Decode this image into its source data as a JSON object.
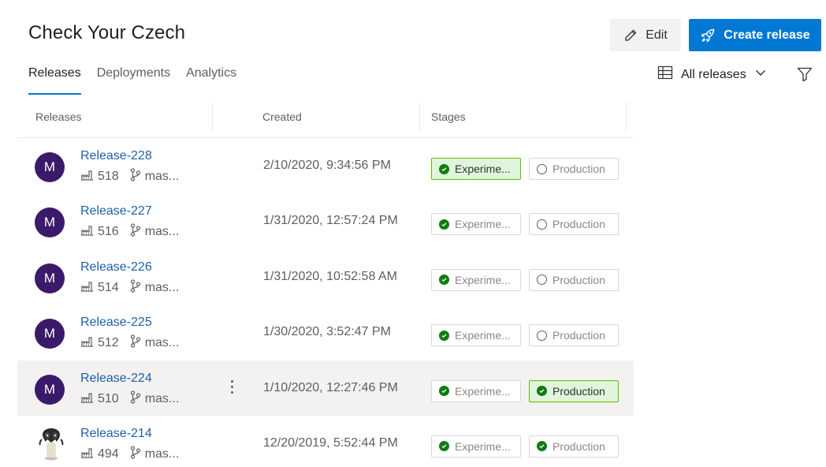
{
  "header": {
    "title": "Check Your Czech",
    "edit_label": "Edit",
    "create_label": "Create release"
  },
  "tabs": [
    {
      "label": "Releases",
      "active": true
    },
    {
      "label": "Deployments",
      "active": false
    },
    {
      "label": "Analytics",
      "active": false
    }
  ],
  "view": {
    "label": "All releases",
    "icon": "table-grid-icon",
    "filter_icon": "filter-icon"
  },
  "table": {
    "columns": [
      "Releases",
      "Created",
      "Stages"
    ],
    "rows": [
      {
        "name": "Release-228",
        "build": "518",
        "branch": "mas...",
        "created": "2/10/2020, 9:34:56 PM",
        "avatar": "M",
        "stages": [
          {
            "label": "Experime...",
            "status": "succeeded",
            "highlight": true
          },
          {
            "label": "Production",
            "status": "not-deployed",
            "highlight": false
          }
        ]
      },
      {
        "name": "Release-227",
        "build": "516",
        "branch": "mas...",
        "created": "1/31/2020, 12:57:24 PM",
        "avatar": "M",
        "stages": [
          {
            "label": "Experime...",
            "status": "succeeded",
            "highlight": false
          },
          {
            "label": "Production",
            "status": "not-deployed",
            "highlight": false
          }
        ]
      },
      {
        "name": "Release-226",
        "build": "514",
        "branch": "mas...",
        "created": "1/31/2020, 10:52:58 AM",
        "avatar": "M",
        "stages": [
          {
            "label": "Experime...",
            "status": "succeeded",
            "highlight": false
          },
          {
            "label": "Production",
            "status": "not-deployed",
            "highlight": false
          }
        ]
      },
      {
        "name": "Release-225",
        "build": "512",
        "branch": "mas...",
        "created": "1/30/2020, 3:52:47 PM",
        "avatar": "M",
        "stages": [
          {
            "label": "Experime...",
            "status": "succeeded",
            "highlight": false
          },
          {
            "label": "Production",
            "status": "not-deployed",
            "highlight": false
          }
        ]
      },
      {
        "name": "Release-224",
        "build": "510",
        "branch": "mas...",
        "created": "1/10/2020, 12:27:46 PM",
        "avatar": "M",
        "selected": true,
        "stages": [
          {
            "label": "Experime...",
            "status": "succeeded",
            "highlight": false
          },
          {
            "label": "Production",
            "status": "succeeded",
            "highlight": true
          }
        ]
      },
      {
        "name": "Release-214",
        "build": "494",
        "branch": "mas...",
        "created": "12/20/2019, 5:52:44 PM",
        "avatar": "image",
        "stages": [
          {
            "label": "Experime...",
            "status": "succeeded",
            "highlight": false
          },
          {
            "label": "Production",
            "status": "succeeded",
            "highlight": false
          }
        ]
      }
    ]
  },
  "colors": {
    "accent": "#0078d4",
    "link": "#1f5fa8",
    "avatar": "#3b1a6b",
    "success": "#107c10",
    "success_bg": "#dff6dd"
  }
}
